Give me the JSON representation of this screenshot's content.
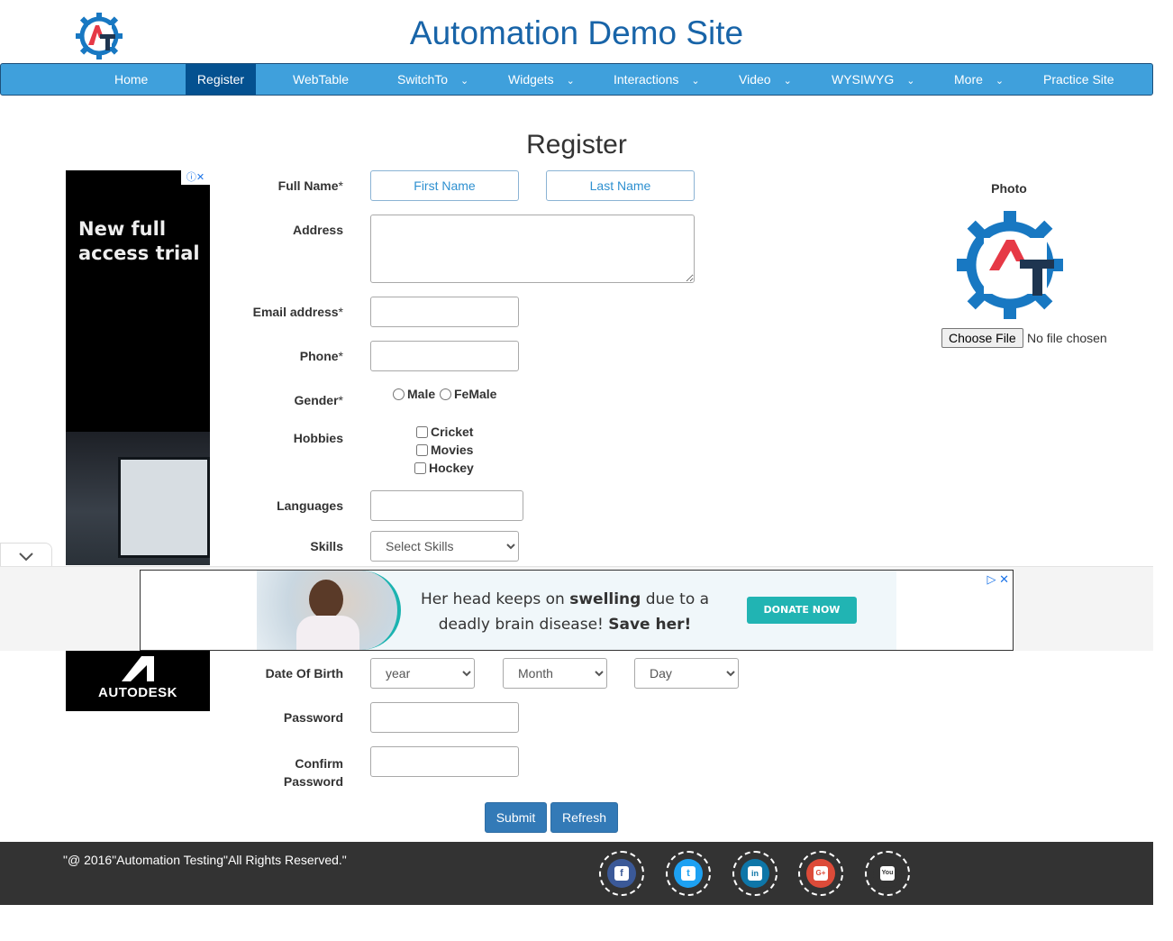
{
  "header": {
    "site_title": "Automation Demo Site"
  },
  "nav": {
    "items": [
      {
        "label": "Home"
      },
      {
        "label": "Register"
      },
      {
        "label": "WebTable"
      },
      {
        "label": "SwitchTo"
      },
      {
        "label": "Widgets"
      },
      {
        "label": "Interactions"
      },
      {
        "label": "Video"
      },
      {
        "label": "WYSIWYG"
      },
      {
        "label": "More"
      },
      {
        "label": "Practice Site"
      }
    ],
    "active": "Register",
    "accent_color": "#3fa0dc",
    "active_color": "#045190"
  },
  "page": {
    "title": "Register"
  },
  "form": {
    "full_name": {
      "label": "Full Name",
      "required_mark": "*",
      "first_placeholder": "First Name",
      "last_placeholder": "Last Name"
    },
    "address": {
      "label": "Address"
    },
    "email": {
      "label": "Email address",
      "required_mark": "*"
    },
    "phone": {
      "label": "Phone",
      "required_mark": "*"
    },
    "gender": {
      "label": "Gender",
      "required_mark": "*",
      "options": [
        "Male",
        "FeMale"
      ]
    },
    "hobbies": {
      "label": "Hobbies",
      "options": [
        "Cricket",
        "Movies",
        "Hockey"
      ]
    },
    "languages": {
      "label": "Languages"
    },
    "skills": {
      "label": "Skills",
      "selected": "Select Skills"
    },
    "dob": {
      "label": "Date Of Birth",
      "year": "year",
      "month": "Month",
      "day": "Day"
    },
    "password": {
      "label": "Password"
    },
    "confirm_password": {
      "label_line1": "Confirm",
      "label_line2": "Password"
    },
    "submit_label": "Submit",
    "refresh_label": "Refresh"
  },
  "photo": {
    "label": "Photo",
    "choose_file_label": "Choose File",
    "file_status": "No file chosen"
  },
  "ads": {
    "left_headline_line1": "New full",
    "left_headline_line2": "access trial",
    "left_bottom_brand": "AUTODESK",
    "bottom_message_part1": "Her head keeps on ",
    "bottom_message_bold1": "swelling",
    "bottom_message_part2": " due to a deadly brain disease! ",
    "bottom_message_bold2": "Save her!",
    "bottom_cta": "DONATE NOW"
  },
  "footer": {
    "copyright": "\"@ 2016\"Automation Testing\"All Rights Reserved.\"",
    "social_icons": [
      {
        "name": "facebook-icon",
        "color": "#3b5998",
        "glyph": "f"
      },
      {
        "name": "twitter-icon",
        "color": "#1da1f2",
        "glyph": "t"
      },
      {
        "name": "linkedin-icon",
        "color": "#0e76a8",
        "glyph": "in"
      },
      {
        "name": "google-plus-icon",
        "color": "#dd4b39",
        "glyph": "G+"
      },
      {
        "name": "youtube-icon",
        "color": "#333333",
        "glyph": "You"
      }
    ]
  }
}
